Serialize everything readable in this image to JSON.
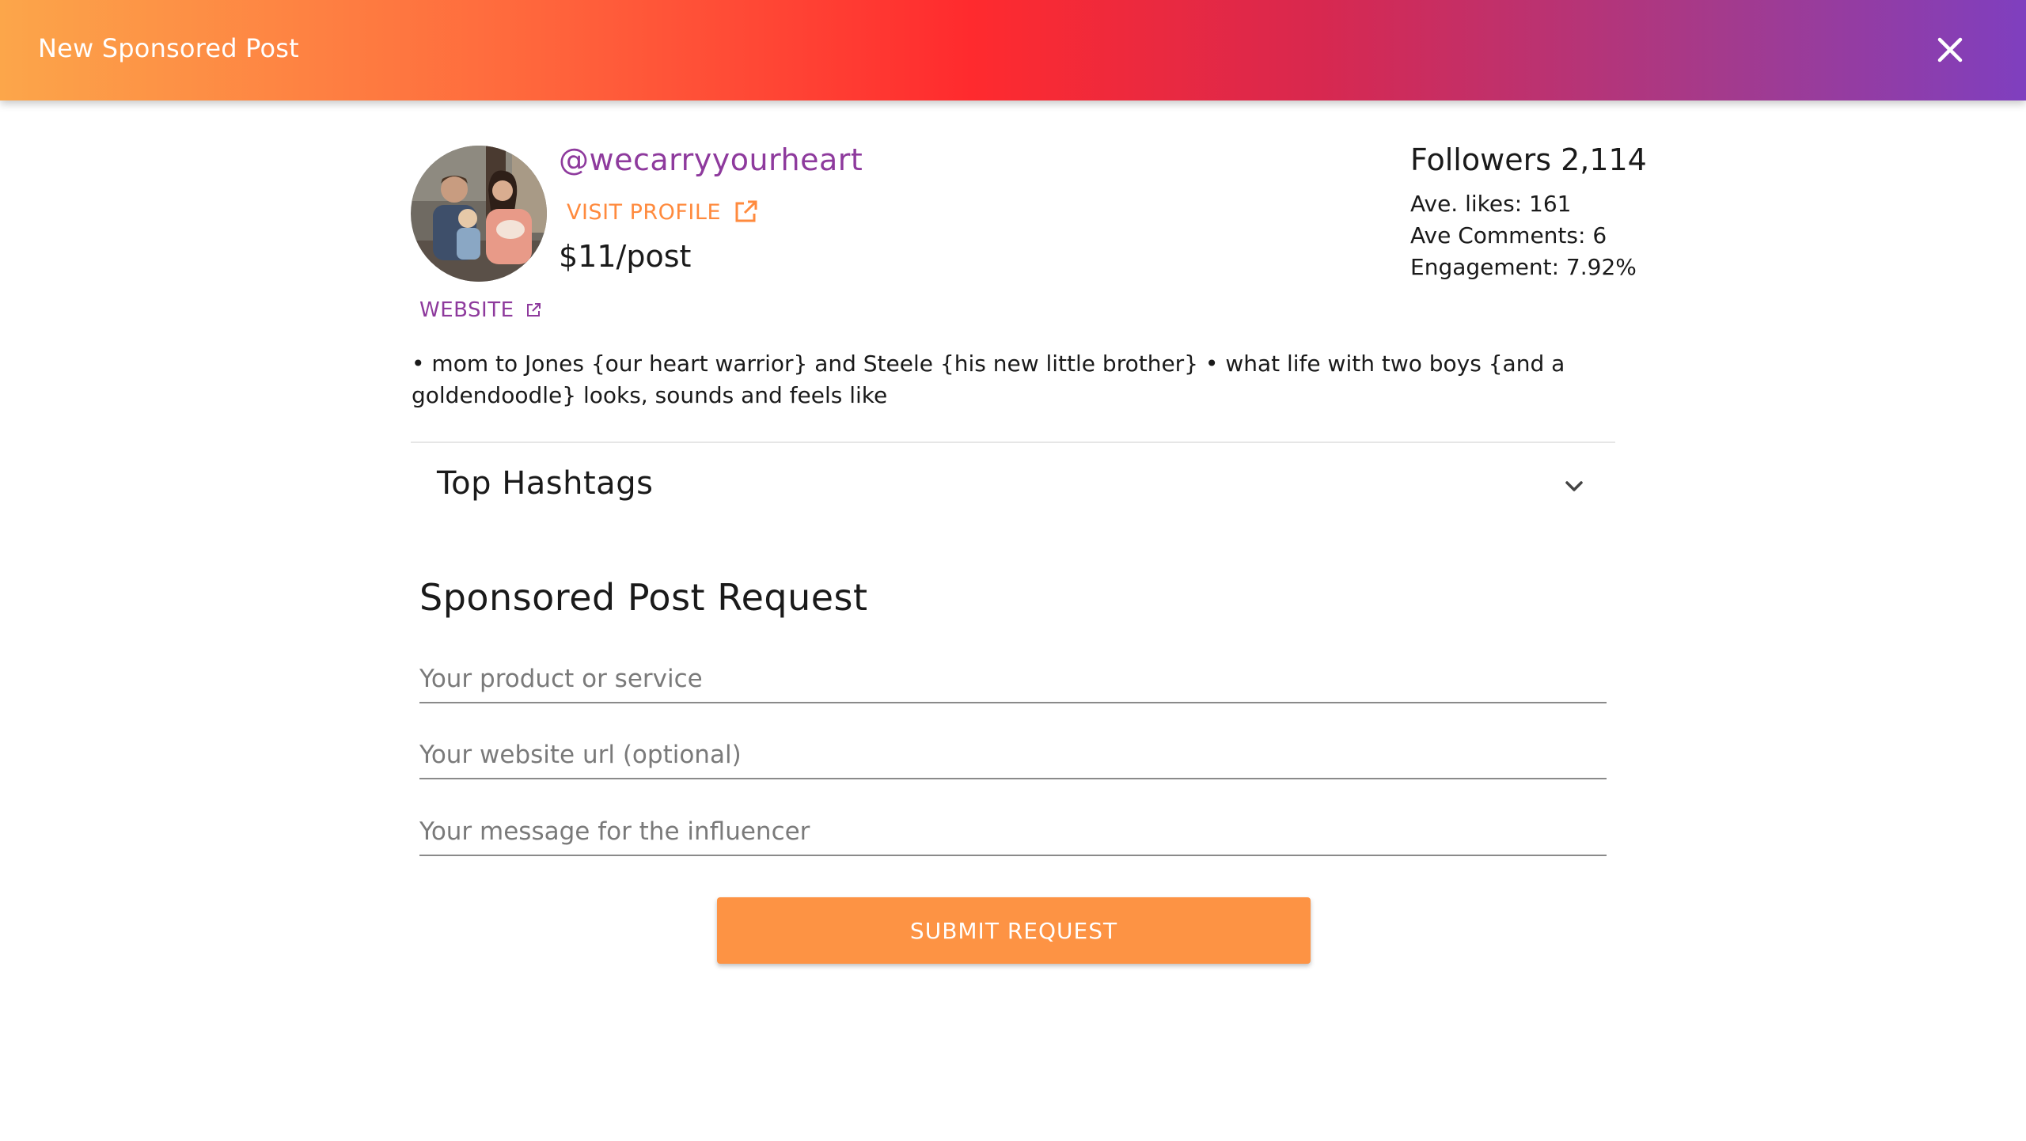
{
  "header": {
    "title": "New Sponsored Post",
    "close_icon": "close-icon"
  },
  "profile": {
    "handle": "@wecarryyourheart",
    "visit_profile_label": "VISIT PROFILE",
    "price": "$11/post",
    "website_label": "WEBSITE",
    "bio": "• mom to Jones {our heart warrior} and Steele {his new little brother} • what life with two boys {and a goldendoodle} looks, sounds and feels like",
    "accent_purple": "#8e3a9d",
    "accent_orange": "#ff8a3d"
  },
  "stats": {
    "followers": "Followers 2,114",
    "avg_likes": "Ave. likes: 161",
    "avg_comments": "Ave Comments: 6",
    "engagement": "Engagement: 7.92%"
  },
  "hashtags": {
    "title": "Top Hashtags",
    "chevron_icon": "chevron-down-icon"
  },
  "request": {
    "title": "Sponsored Post Request",
    "product_placeholder": "Your product or service",
    "website_placeholder": "Your website url (optional)",
    "message_placeholder": "Your message for the influencer",
    "submit_label": "SUBMIT REQUEST",
    "submit_color": "#fd9344"
  }
}
